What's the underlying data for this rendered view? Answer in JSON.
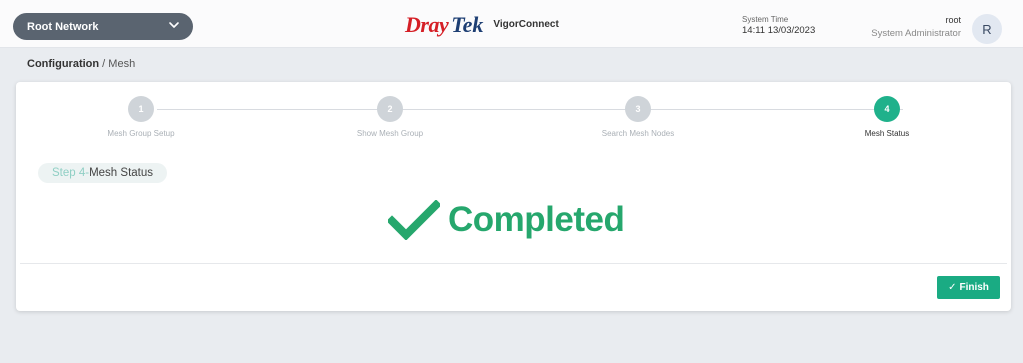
{
  "header": {
    "network_selector": "Root Network",
    "brand_dray": "Dray",
    "brand_tek": "Tek",
    "app_name": "VigorConnect",
    "system_time_label": "System Time",
    "system_time_value": "14:11 13/03/2023",
    "user_name": "root",
    "user_role": "System Administrator",
    "avatar_initial": "R"
  },
  "breadcrumb": {
    "section": "Configuration",
    "separator": "/",
    "page": "Mesh"
  },
  "wizard": {
    "steps": [
      {
        "number": "1",
        "label": "Mesh Group Setup",
        "active": false
      },
      {
        "number": "2",
        "label": "Show Mesh Group",
        "active": false
      },
      {
        "number": "3",
        "label": "Search Mesh Nodes",
        "active": false
      },
      {
        "number": "4",
        "label": "Mesh Status",
        "active": true
      }
    ],
    "step_pill_prefix": "Step 4-",
    "step_pill_title": "Mesh Status",
    "status_text": "Completed",
    "finish_label": "Finish"
  },
  "colors": {
    "accent": "#1fb18b",
    "completed": "#26a76d",
    "brand_red": "#d51f26",
    "brand_blue": "#1d3e73"
  },
  "icons": [
    "chevron-down-icon",
    "check-icon"
  ]
}
